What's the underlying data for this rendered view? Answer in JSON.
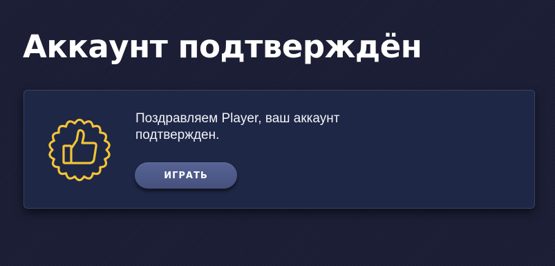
{
  "page": {
    "title": "Аккаунт подтверждён"
  },
  "card": {
    "message": "Поздравляем Player, ваш аккаунт подтвержден.",
    "button_label": "ИГРАТЬ",
    "icon": "thumbs-up-badge-icon"
  },
  "colors": {
    "background": "#1b1d34",
    "card_background": "#1f2746",
    "accent_yellow": "#f2c438",
    "button": "#4f5b8a",
    "text": "#ffffff"
  }
}
